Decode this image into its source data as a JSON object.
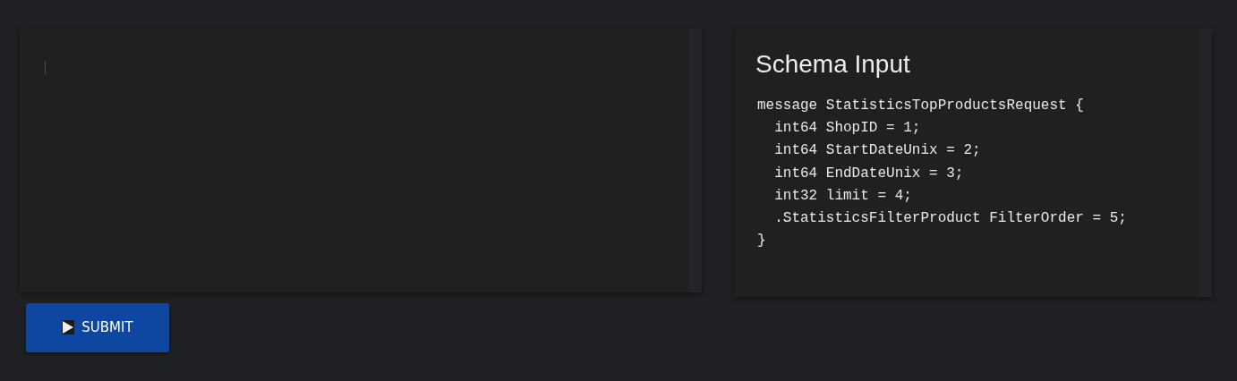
{
  "schema_panel": {
    "title": "Schema Input",
    "code_lines": [
      "message StatisticsTopProductsRequest {",
      "  int64 ShopID = 1;",
      "  int64 StartDateUnix = 2;",
      "  int64 EndDateUnix = 3;",
      "  int32 limit = 4;",
      "  .StatisticsFilterProduct FilterOrder = 5;",
      "}"
    ]
  },
  "submit_button": {
    "label": "SUBMIT"
  }
}
